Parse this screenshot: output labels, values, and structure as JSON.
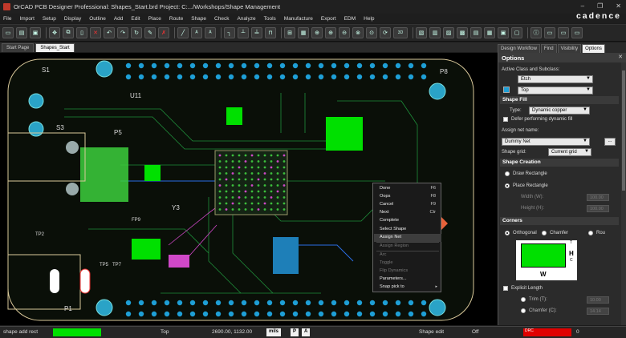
{
  "window": {
    "title": "OrCAD PCB Designer Professional: Shapes_Start.brd  Project: C:.../Workshops/Shape Management",
    "min": "–",
    "max": "❐",
    "close": "✕"
  },
  "brand": "cadence",
  "menu": [
    "File",
    "Import",
    "Setup",
    "Display",
    "Outline",
    "Add",
    "Edit",
    "Place",
    "Route",
    "Shape",
    "Check",
    "Analyze",
    "Tools",
    "Manufacture",
    "Export",
    "EDM",
    "Help"
  ],
  "tabs": {
    "start_page": "Start Page",
    "shapes_start": "Shapes_Start"
  },
  "right_tabs": [
    "Design Workflow",
    "Find",
    "Visibility",
    "Options"
  ],
  "board_labels": {
    "s1": "S1",
    "s3": "S3",
    "p1": "P1",
    "p5": "P5",
    "p8": "P8",
    "u11": "U11",
    "y3": "Y3",
    "tp5": "TP5",
    "tp7": "TP7",
    "fp9": "FP9",
    "tp2": "TP2"
  },
  "options": {
    "header": "Options",
    "close": "✕",
    "active_class_label": "Active Class and Subclass:",
    "class_value": "Etch",
    "subclass_value": "Top",
    "shape_fill_header": "Shape Fill",
    "type_label": "Type:",
    "type_value": "Dynamic copper",
    "defer_label": "Defer performing dynamic fill",
    "assign_net_label": "Assign net name:",
    "net_value": "Dummy Net",
    "net_btn": "...",
    "shape_grid_label": "Shape grid:",
    "shape_grid_value": "Current grid",
    "shape_creation_header": "Shape Creation",
    "draw_rect": "Draw Rectangle",
    "place_rect": "Place Rectangle",
    "width_label": "Width (W):",
    "width_value": "100.00",
    "height_label": "Height (H):",
    "height_value": "100.00",
    "corners_header": "Corners",
    "orthogonal": "Orthogonal",
    "chamfer": "Chamfer",
    "round": "Rou",
    "explicit_length": "Explicit Length",
    "trim_label": "Trim (T):",
    "trim_value": "10.00",
    "chamfer_c_label": "Chamfer (C):",
    "chamfer_c_value": "14.14",
    "diagram_w": "W",
    "diagram_h": "H",
    "diagram_t": "T",
    "diagram_c": "C"
  },
  "context_menu": [
    {
      "label": "Done",
      "shortcut": "F6"
    },
    {
      "label": "Oops",
      "shortcut": "F8"
    },
    {
      "label": "Cancel",
      "shortcut": "F9"
    },
    {
      "label": "Next",
      "shortcut": "Ctr"
    },
    {
      "label": "Complete",
      "shortcut": ""
    },
    {
      "label": "Select Shape",
      "shortcut": ""
    },
    {
      "label": "Assign Net",
      "shortcut": ""
    },
    {
      "label": "Assign Region",
      "shortcut": ""
    },
    {
      "label": "Arc",
      "shortcut": ""
    },
    {
      "label": "Toggle",
      "shortcut": ""
    },
    {
      "label": "Flip Dynamics",
      "shortcut": ""
    },
    {
      "label": "Parameters...",
      "shortcut": ""
    },
    {
      "label": "Snap pick to",
      "shortcut": ""
    }
  ],
  "status": {
    "command": "shape add rect",
    "layer": "Top",
    "coords": "2690.00, 1132.00",
    "units": "mils",
    "p_btn": "P",
    "a_btn": "A",
    "mode": "Shape edit",
    "state": "Off",
    "drc": "DRC",
    "count": "0"
  },
  "colors": {
    "accent_blue": "#1e9fd6",
    "arrow": "#e8623a",
    "copper_green": "#00e000",
    "status_red": "#e00000"
  }
}
